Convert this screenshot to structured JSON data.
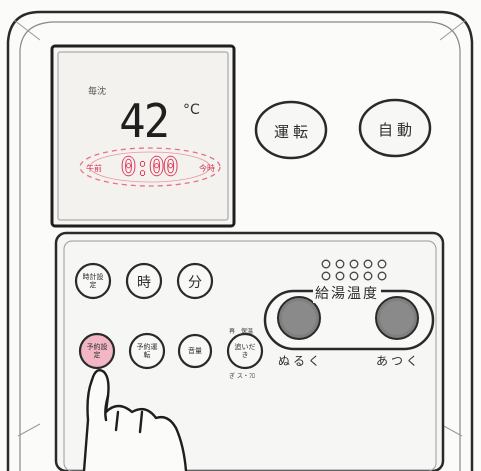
{
  "display": {
    "small_label": "毎沈",
    "temperature": "42",
    "unit": "°C",
    "time": "0:00",
    "left_mark": "午前",
    "right_mark": "今時"
  },
  "buttons": {
    "run": "運転",
    "auto": "自動",
    "clock_set": "時計設定",
    "hour": "時",
    "minute": "分",
    "timer_set": "予約設定",
    "timer_run": "予約運転",
    "volume": "音量",
    "bath": "追いだき",
    "bath_top": "再　保温",
    "bath_bottom": "ぎ ス・ﾌﾛ"
  },
  "temperature_control": {
    "caption": "給湯温度",
    "cooler": "ぬるく",
    "hotter": "あつく",
    "level_dots": 10
  },
  "colors": {
    "outline": "#2a2a2a",
    "lcd_red": "#e23b58",
    "highlight_button": "#f2b6c4"
  }
}
